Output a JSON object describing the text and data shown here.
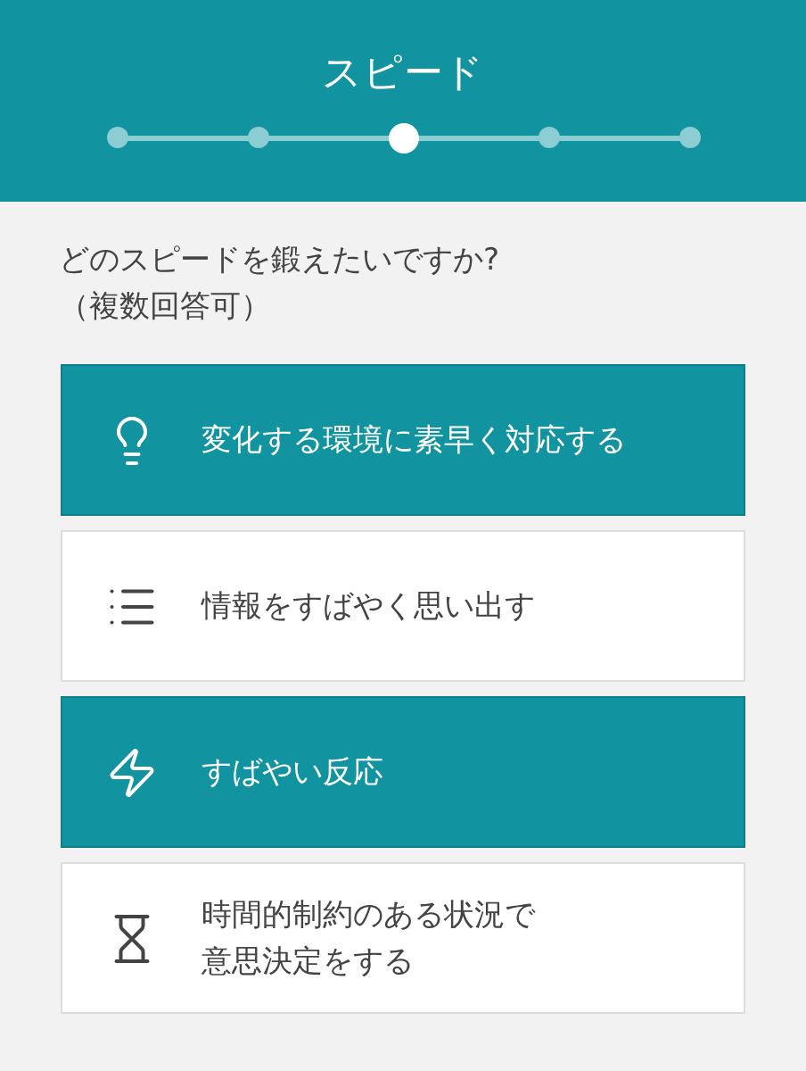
{
  "header": {
    "title": "スピード",
    "steps": [
      {
        "selected": false
      },
      {
        "selected": false
      },
      {
        "selected": true
      },
      {
        "selected": false
      },
      {
        "selected": false
      }
    ]
  },
  "question": "どのスピードを鍛えたいですか?\n（複数回答可）",
  "options": [
    {
      "label": "変化する環境に素早く対応する",
      "selected": true
    },
    {
      "label": "情報をすばやく思い出す",
      "selected": false
    },
    {
      "label": "すばやい反応",
      "selected": true
    },
    {
      "label": "時間的制約のある状況で意思決定をする",
      "selected": false
    }
  ]
}
